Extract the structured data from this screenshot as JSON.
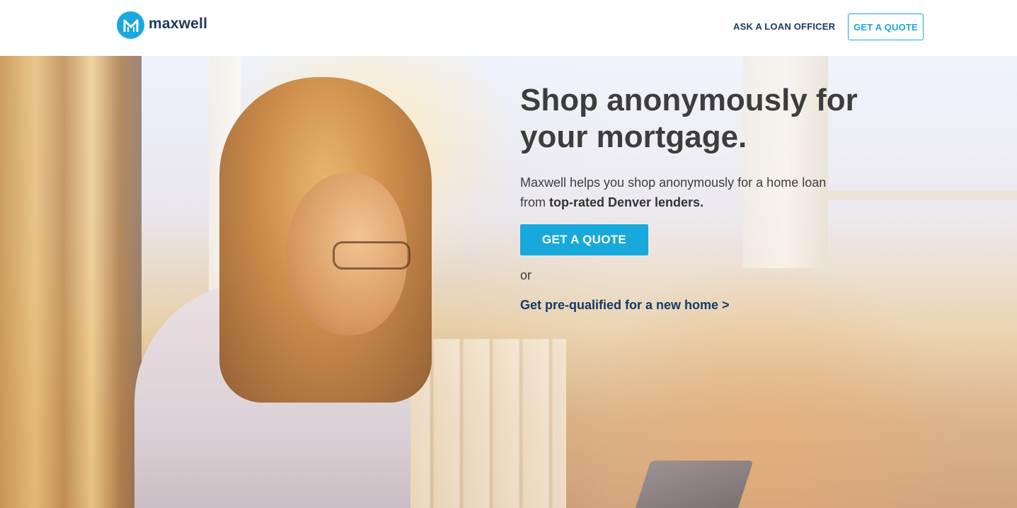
{
  "brand": {
    "logo_letter": "M",
    "name": "maxwell",
    "accent_color": "#1ba8de",
    "navy_color": "#123b66"
  },
  "nav": {
    "ask_officer_label": "ASK A LOAN OFFICER",
    "get_quote_label": "GET A QUOTE"
  },
  "hero": {
    "headline": "Shop anonymously for your mortgage.",
    "subtext_plain": "Maxwell helps you shop anonymously for a home loan from ",
    "subtext_bold": "top-rated Denver lenders.",
    "cta_label": "GET A QUOTE",
    "or_label": "or",
    "prequal_link": "Get pre-qualified for a new home >"
  }
}
